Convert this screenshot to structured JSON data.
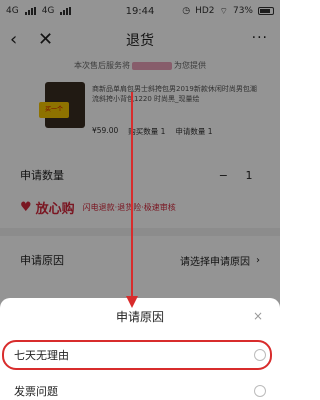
{
  "statusbar": {
    "network1": "4G",
    "network2": "4G",
    "time": "19:44",
    "hd": "HD2",
    "battery": "73%"
  },
  "nav": {
    "back_icon": "chevron-left-icon",
    "close_icon": "close-icon",
    "title": "退货",
    "more_icon": "more-icon"
  },
  "notice": {
    "text_before": "本次售后服务将",
    "text_after": "为您提供"
  },
  "product": {
    "sticker": "买一个",
    "description": "商新品单肩包男士斜挎包男2019新款休闲时尚男包潮流斜挎小背包1220 时尚黑_现量绘",
    "price": "¥59.00",
    "buy_qty": "购买数量 1",
    "apply_qty": "申请数量 1"
  },
  "form": {
    "qty_label": "申请数量",
    "qty_minus": "−",
    "qty_value": "1",
    "safe_brand": "放心购",
    "safe_sub": "闪电退款·退货险·极速审核",
    "reason_label": "申请原因",
    "reason_placeholder": "请选择申请原因",
    "reason_chev": "›"
  },
  "sheet": {
    "title": "申请原因",
    "close": "×",
    "options": [
      "七天无理由",
      "发票问题"
    ]
  },
  "colors": {
    "accent_red": "#d2283c",
    "highlight_red": "#d82c2c"
  }
}
